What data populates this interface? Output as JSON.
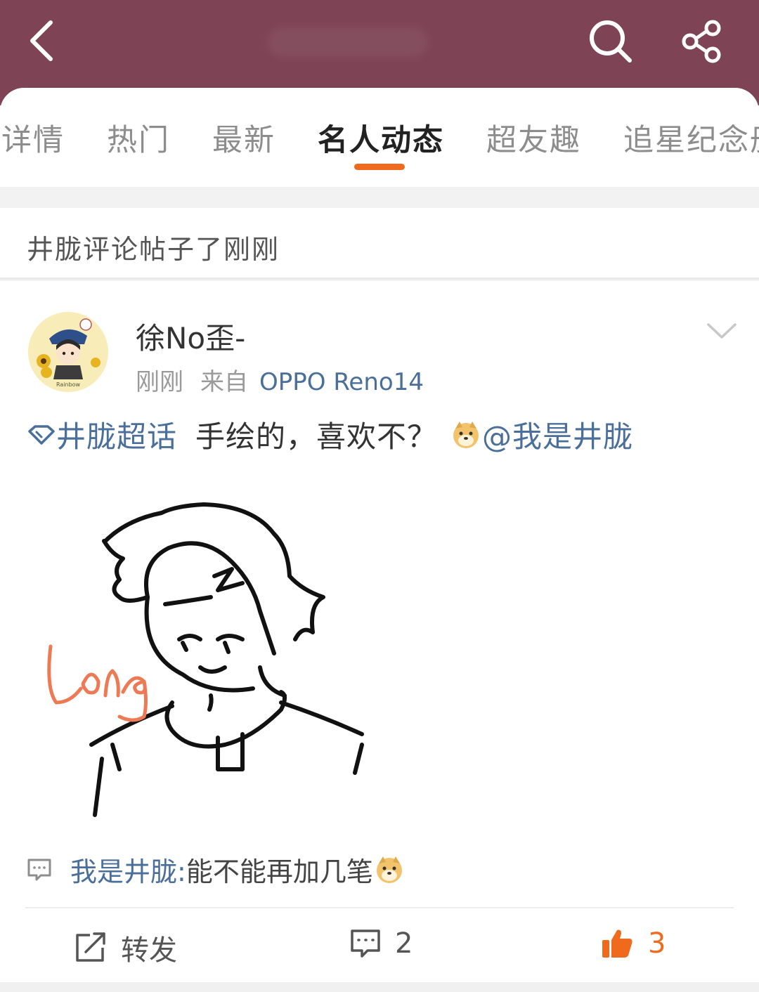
{
  "header": {
    "icons": [
      "back-icon",
      "search-icon",
      "share-icon"
    ],
    "background": "#7e4355"
  },
  "tabs": [
    {
      "label": "详情"
    },
    {
      "label": "热门"
    },
    {
      "label": "最新"
    },
    {
      "label": "名人动态",
      "active": true
    },
    {
      "label": "超友趣"
    },
    {
      "label": "追星纪念册"
    }
  ],
  "section": {
    "title": "井胧评论帖子了刚刚"
  },
  "post": {
    "author": "徐No歪-",
    "time": "刚刚",
    "source_prefix": "来自",
    "device": "OPPO Reno14",
    "topic": "井胧超话",
    "text": "手绘的，喜欢不？",
    "mention": "@我是井胧",
    "drawing_label": "Long",
    "hot_comment": {
      "author": "我是井胧:",
      "text": " 能不能再加几笔"
    },
    "actions": {
      "repost": "转发",
      "comments": "2",
      "likes": "3"
    }
  },
  "colors": {
    "accent": "#f06a1d",
    "link": "#4a6f9a"
  }
}
